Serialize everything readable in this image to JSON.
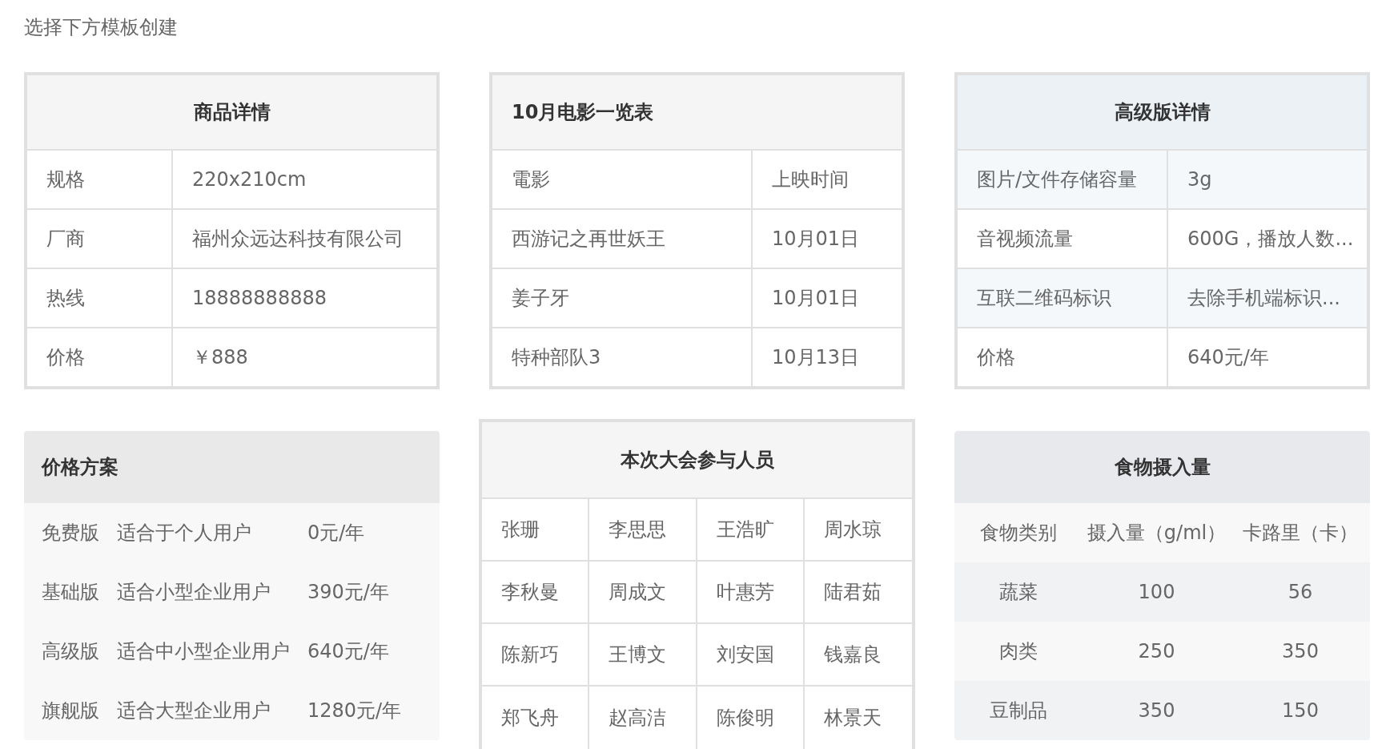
{
  "heading": "选择下方模板创建",
  "tables": [
    {
      "kind": "detail",
      "title": "商品详情",
      "rows": [
        [
          "规格",
          "220x210cm"
        ],
        [
          "厂商",
          "福州众远达科技有限公司"
        ],
        [
          "热线",
          "18888888888"
        ],
        [
          "价格",
          "￥888"
        ]
      ]
    },
    {
      "kind": "list",
      "title": "10月电影一览表",
      "rows": [
        [
          "電影",
          "上映时间"
        ],
        [
          "西游记之再世妖王",
          "10月01日"
        ],
        [
          "姜子牙",
          "10月01日"
        ],
        [
          "特种部队3",
          "10月13日"
        ]
      ]
    },
    {
      "kind": "tinted",
      "title": "高级版详情",
      "rows": [
        [
          "图片/文件存储容量",
          "3g"
        ],
        [
          "音视频流量",
          "600G，播放人数..."
        ],
        [
          "互联二维码标识",
          "去除手机端标识..."
        ],
        [
          "价格",
          "640元/年"
        ]
      ]
    },
    {
      "kind": "plan",
      "title": "价格方案",
      "rows": [
        [
          "免费版",
          "适合于个人用户",
          "0元/年"
        ],
        [
          "基础版",
          "适合小型企业用户",
          "390元/年"
        ],
        [
          "高级版",
          "适合中小型企业用户",
          "640元/年"
        ],
        [
          "旗舰版",
          "适合大型企业用户",
          "1280元/年"
        ]
      ]
    },
    {
      "kind": "people",
      "title": "本次大会参与人员",
      "rows": [
        [
          "张珊",
          "李思思",
          "王浩旷",
          "周水琼"
        ],
        [
          "李秋曼",
          "周成文",
          "叶惠芳",
          "陆君茹"
        ],
        [
          "陈新巧",
          "王博文",
          "刘安国",
          "钱嘉良"
        ],
        [
          "郑飞舟",
          "赵高洁",
          "陈俊明",
          "林景天"
        ]
      ]
    },
    {
      "kind": "food",
      "title": "食物摄入量",
      "rows": [
        [
          "食物类别",
          "摄入量（g/ml）",
          "卡路里（卡）"
        ],
        [
          "蔬菜",
          "100",
          "56"
        ],
        [
          "肉类",
          "250",
          "350"
        ],
        [
          "豆制品",
          "350",
          "150"
        ]
      ]
    }
  ]
}
